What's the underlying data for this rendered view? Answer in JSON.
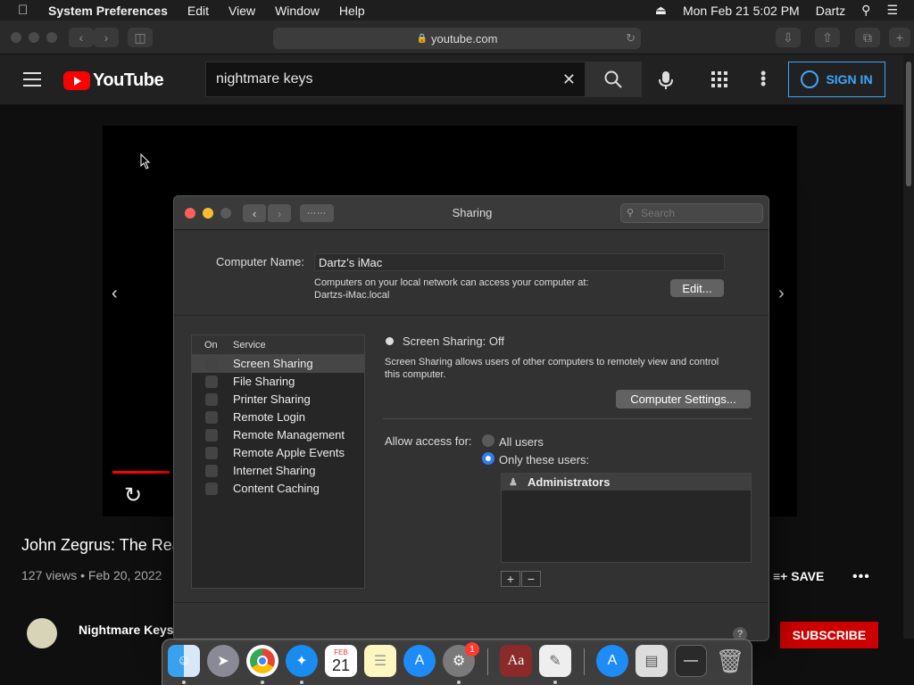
{
  "menubar": {
    "app": "System Preferences",
    "items": [
      "Edit",
      "View",
      "Window",
      "Help"
    ],
    "clock": "Mon Feb 21  5:02 PM",
    "user": "Dartz"
  },
  "safari": {
    "url": "youtube.com"
  },
  "youtube": {
    "logo_text": "YouTube",
    "search_value": "nightmare keys",
    "sign_in": "SIGN IN",
    "video_title": "John Zegrus: The Rea",
    "meta": "127 views • Feb 20, 2022",
    "save": "SAVE",
    "channel": "Nightmare Keys",
    "subscribe": "SUBSCRIBE",
    "progress_fraction": 0.085
  },
  "sharing": {
    "title": "Sharing",
    "search_placeholder": "Search",
    "computer_name_label": "Computer Name:",
    "computer_name": "Dartz’s iMac",
    "note_line1": "Computers on your local network can access your computer at:",
    "note_line2": "Dartzs-iMac.local",
    "edit_button": "Edit...",
    "col_on": "On",
    "col_service": "Service",
    "services": [
      {
        "label": "Screen Sharing",
        "on": false,
        "selected": true
      },
      {
        "label": "File Sharing",
        "on": false,
        "selected": false
      },
      {
        "label": "Printer Sharing",
        "on": false,
        "selected": false
      },
      {
        "label": "Remote Login",
        "on": false,
        "selected": false
      },
      {
        "label": "Remote Management",
        "on": false,
        "selected": false
      },
      {
        "label": "Remote Apple Events",
        "on": false,
        "selected": false
      },
      {
        "label": "Internet Sharing",
        "on": false,
        "selected": false
      },
      {
        "label": "Content Caching",
        "on": false,
        "selected": false
      }
    ],
    "status": "Screen Sharing: Off",
    "description_line1": "Screen Sharing allows users of other computers to remotely view and control",
    "description_line2": "this computer.",
    "computer_settings": "Computer Settings...",
    "allow_label": "Allow access for:",
    "all_users": "All users",
    "only_these": "Only these users:",
    "user_list": [
      "Administrators"
    ],
    "add": "+",
    "remove": "−"
  },
  "dock": {
    "calendar_month": "FEB",
    "calendar_day": "21",
    "prefs_badge": "1"
  }
}
